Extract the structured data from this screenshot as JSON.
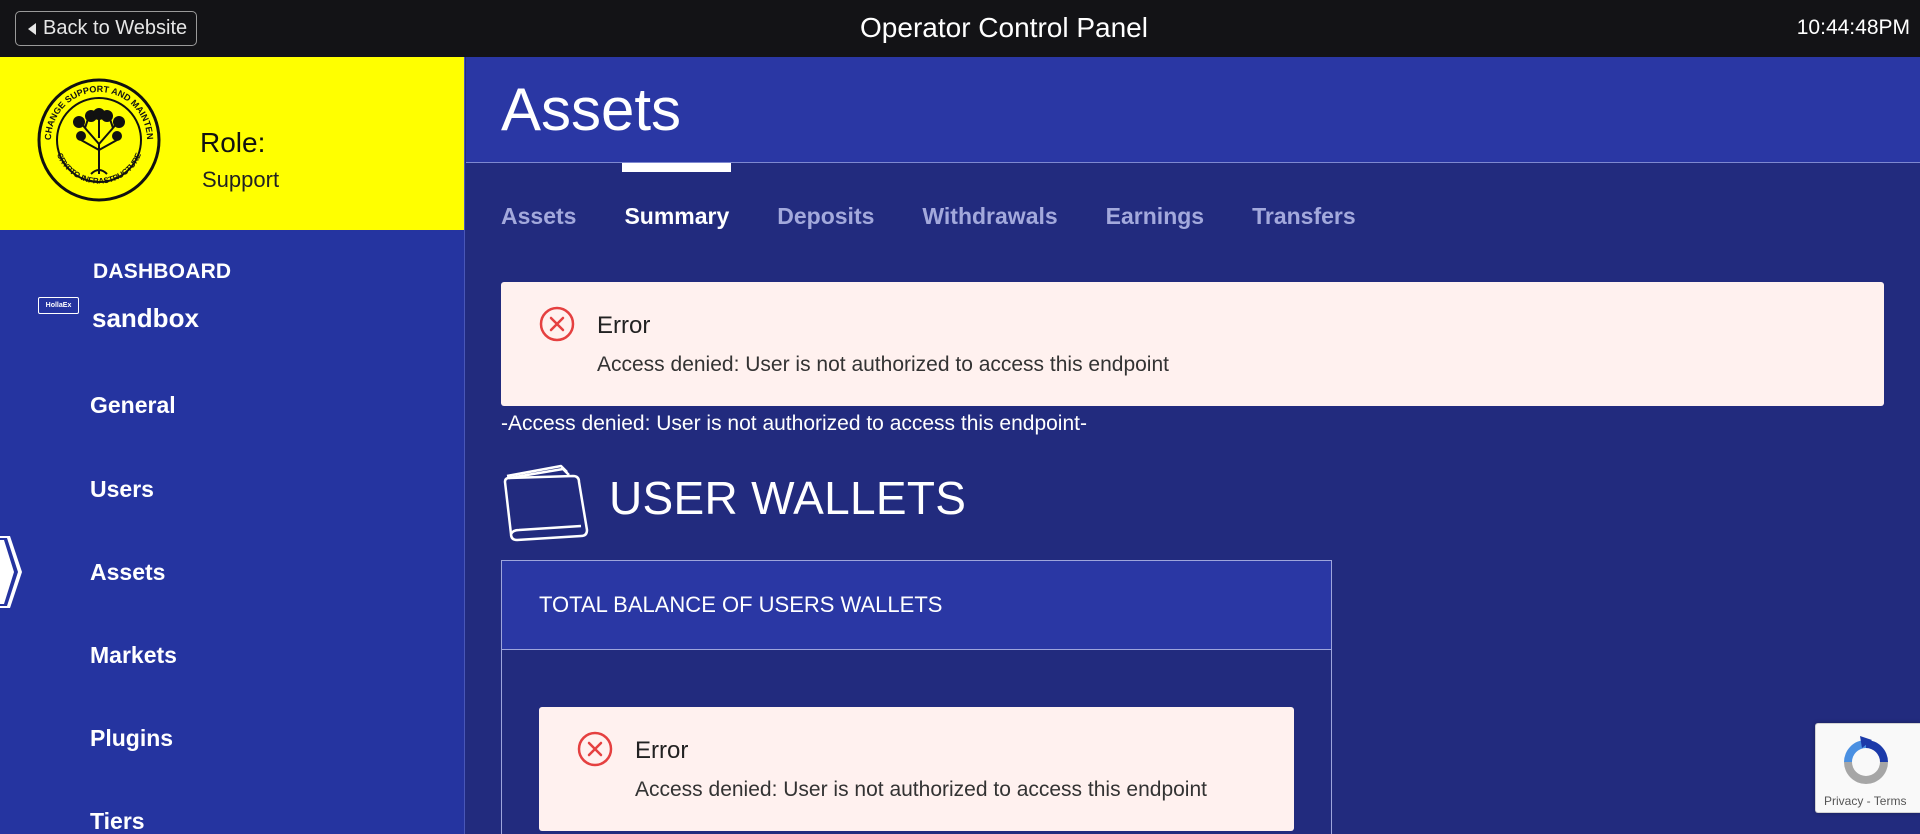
{
  "topbar": {
    "back_label": "Back to Website",
    "title": "Operator Control Panel",
    "clock": "10:44:48PM"
  },
  "sidebar": {
    "role_label": "Role:",
    "role_value": "Support",
    "logo_text": "HollaEx",
    "dashboard_label": "DASHBOARD",
    "environment": "sandbox",
    "nav": [
      {
        "label": "General",
        "active": false
      },
      {
        "label": "Users",
        "active": false
      },
      {
        "label": "Assets",
        "active": true
      },
      {
        "label": "Markets",
        "active": false
      },
      {
        "label": "Plugins",
        "active": false
      },
      {
        "label": "Tiers",
        "active": false
      }
    ]
  },
  "main": {
    "title": "Assets",
    "tabs": [
      {
        "label": "Assets",
        "active": false
      },
      {
        "label": "Summary",
        "active": true
      },
      {
        "label": "Deposits",
        "active": false
      },
      {
        "label": "Withdrawals",
        "active": false
      },
      {
        "label": "Earnings",
        "active": false
      },
      {
        "label": "Transfers",
        "active": false
      }
    ],
    "error_alert": {
      "title": "Error",
      "message": "Access denied: User is not authorized to access this endpoint"
    },
    "error_inline": "-Access denied: User is not authorized to access this endpoint-",
    "wallets_title": "USER WALLETS",
    "balance_card": {
      "header": "TOTAL BALANCE OF USERS WALLETS",
      "error_title": "Error",
      "error_message": "Access denied: User is not authorized to access this endpoint"
    }
  },
  "recaptcha": {
    "text": "Privacy - Terms"
  },
  "colors": {
    "accent_yellow": "#ffff00",
    "sidebar_blue": "#2534a0",
    "main_blue": "#222b7e",
    "error_red": "#e54040"
  }
}
